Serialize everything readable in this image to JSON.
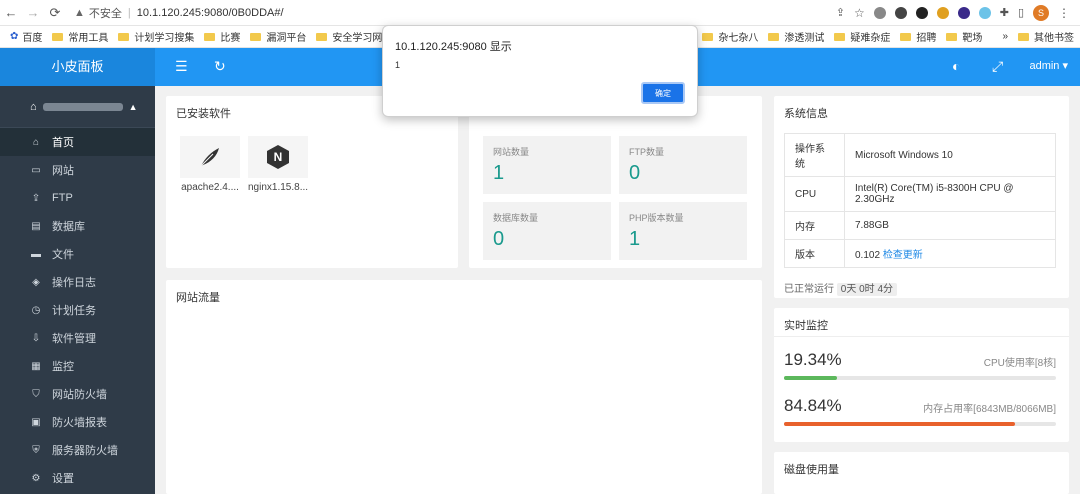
{
  "browser": {
    "security_label": "不安全",
    "url": "10.1.120.245:9080/0B0DDA#/",
    "profile_initial": "S"
  },
  "bookmarks": {
    "items": [
      "百度",
      "常用工具",
      "计划学习搜集",
      "比赛",
      "漏洞平台",
      "安全学习网站",
      "杂七杂八",
      "渗透测试",
      "疑难杂症",
      "招聘",
      "靶场"
    ],
    "more": "»",
    "other": "其他书签"
  },
  "header": {
    "brand": "小皮面板",
    "user": "admin"
  },
  "sidebar": {
    "items": [
      {
        "label": "首页",
        "icon": "home-icon"
      },
      {
        "label": "网站",
        "icon": "monitor-icon"
      },
      {
        "label": "FTP",
        "icon": "upload-icon"
      },
      {
        "label": "数据库",
        "icon": "database-icon"
      },
      {
        "label": "文件",
        "icon": "folder-icon"
      },
      {
        "label": "操作日志",
        "icon": "layers-icon"
      },
      {
        "label": "计划任务",
        "icon": "clock-icon"
      },
      {
        "label": "软件管理",
        "icon": "download-icon"
      },
      {
        "label": "监控",
        "icon": "chart-icon"
      },
      {
        "label": "网站防火墙",
        "icon": "shield-icon"
      },
      {
        "label": "防火墙报表",
        "icon": "report-icon"
      },
      {
        "label": "服务器防火墙",
        "icon": "server-shield-icon"
      },
      {
        "label": "设置",
        "icon": "gear-icon"
      }
    ]
  },
  "installed": {
    "title": "已安装软件",
    "apps": [
      {
        "name": "apache2.4....",
        "icon": "feather-icon"
      },
      {
        "name": "nginx1.15.8...",
        "icon": "nginx-icon"
      }
    ]
  },
  "stats": [
    {
      "label": "网站数量",
      "value": "1"
    },
    {
      "label": "FTP数量",
      "value": "0"
    },
    {
      "label": "数据库数量",
      "value": "0"
    },
    {
      "label": "PHP版本数量",
      "value": "1"
    }
  ],
  "traffic": {
    "title": "网站流量"
  },
  "sysinfo": {
    "title": "系统信息",
    "rows": [
      {
        "key": "操作系统",
        "value": "Microsoft Windows 10"
      },
      {
        "key": "CPU",
        "value": "Intel(R) Core(TM) i5-8300H CPU @ 2.30GHz"
      },
      {
        "key": "内存",
        "value": "7.88GB"
      },
      {
        "key": "版本",
        "value": "0.102",
        "link": "检查更新"
      }
    ],
    "uptime_label": "已正常运行",
    "uptime_value": "0天 0时 4分"
  },
  "monitor": {
    "title": "实时监控",
    "cpu": {
      "percent": "19.34%",
      "label": "CPU使用率[8核]",
      "fraction": 0.1934,
      "color": "#5cb85c"
    },
    "mem": {
      "percent": "84.84%",
      "label": "内存占用率[6843MB/8066MB]",
      "fraction": 0.8484,
      "color": "#e8612c"
    }
  },
  "disk": {
    "title": "磁盘使用量"
  },
  "dialog": {
    "title": "10.1.120.245:9080 显示",
    "message": "1",
    "ok_label": "确定"
  }
}
